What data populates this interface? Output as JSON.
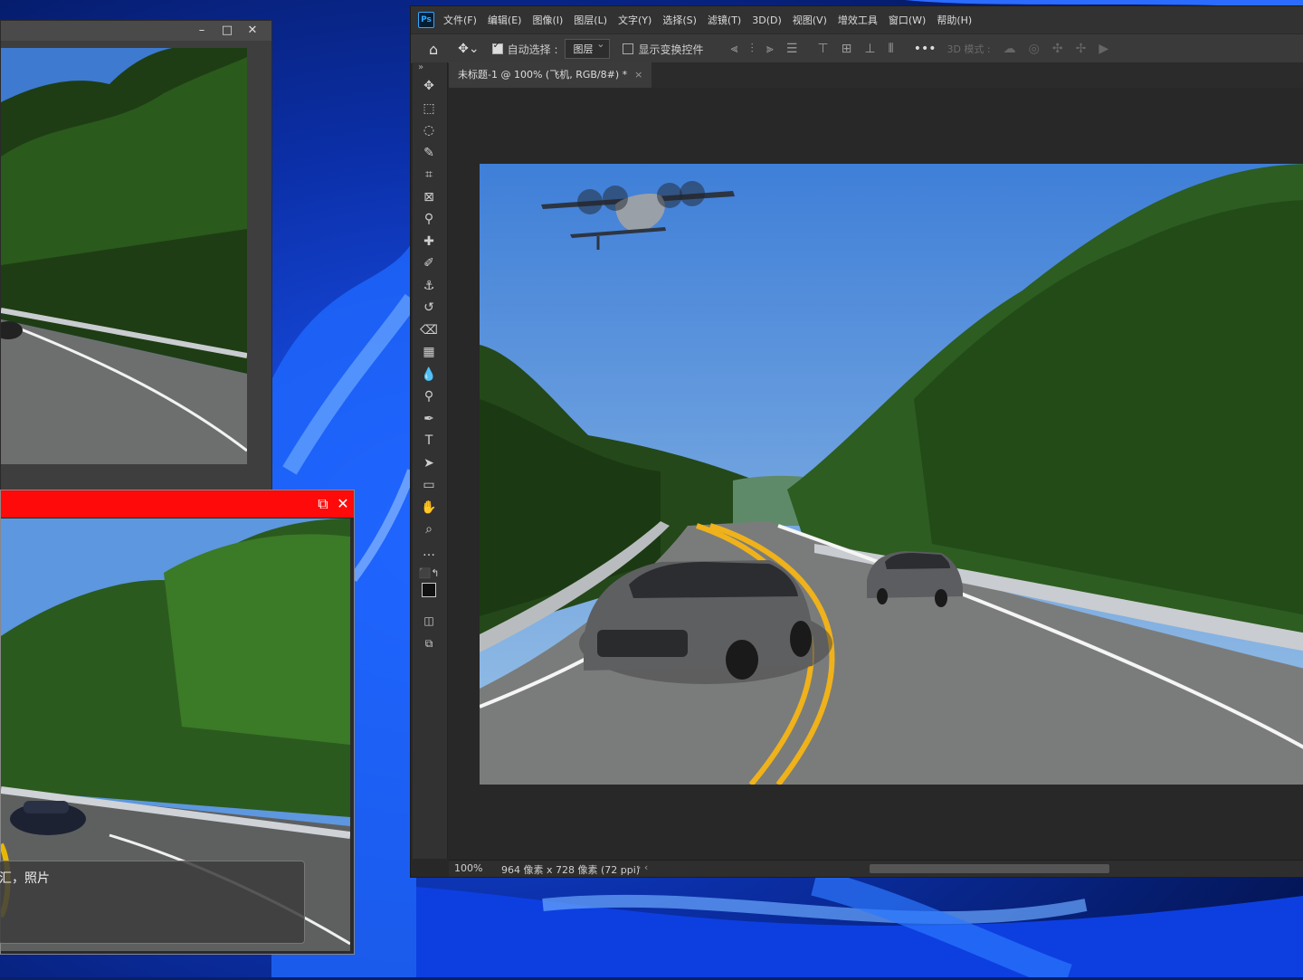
{
  "photoshop": {
    "logo": "Ps",
    "menu": [
      "文件(F)",
      "编辑(E)",
      "图像(I)",
      "图层(L)",
      "文字(Y)",
      "选择(S)",
      "滤镜(T)",
      "3D(D)",
      "视图(V)",
      "增效工具",
      "窗口(W)",
      "帮助(H)"
    ],
    "options": {
      "auto_select_label": "自动选择 :",
      "auto_select_checked": true,
      "layer_dropdown": "图层",
      "show_transform_label": "显示变换控件",
      "show_transform_checked": false,
      "mode_3d_label": "3D 模式 :"
    },
    "tab": {
      "title": "未标题-1 @ 100% (飞机, RGB/8#) *",
      "close": "×"
    },
    "status": {
      "zoom": "100%",
      "info": "964 像素 x 728 像素 (72 ppi)"
    },
    "toolbar_icons": [
      "move-icon",
      "marquee-icon",
      "lasso-icon",
      "quick-select-icon",
      "crop-icon",
      "frame-icon",
      "eyedropper-icon",
      "healing-brush-icon",
      "brush-icon",
      "stamp-icon",
      "history-brush-icon",
      "eraser-icon",
      "gradient-icon",
      "blur-icon",
      "dodge-icon",
      "pen-icon",
      "type-icon",
      "path-select-icon",
      "rectangle-icon",
      "hand-icon",
      "zoom-icon",
      "more-tools-icon"
    ]
  },
  "red_window": {
    "caption": "汇，照片"
  },
  "colors": {
    "ps_bg": "#282828",
    "red_titlebar": "#ff0a0a",
    "sky": "#4a86d6"
  }
}
